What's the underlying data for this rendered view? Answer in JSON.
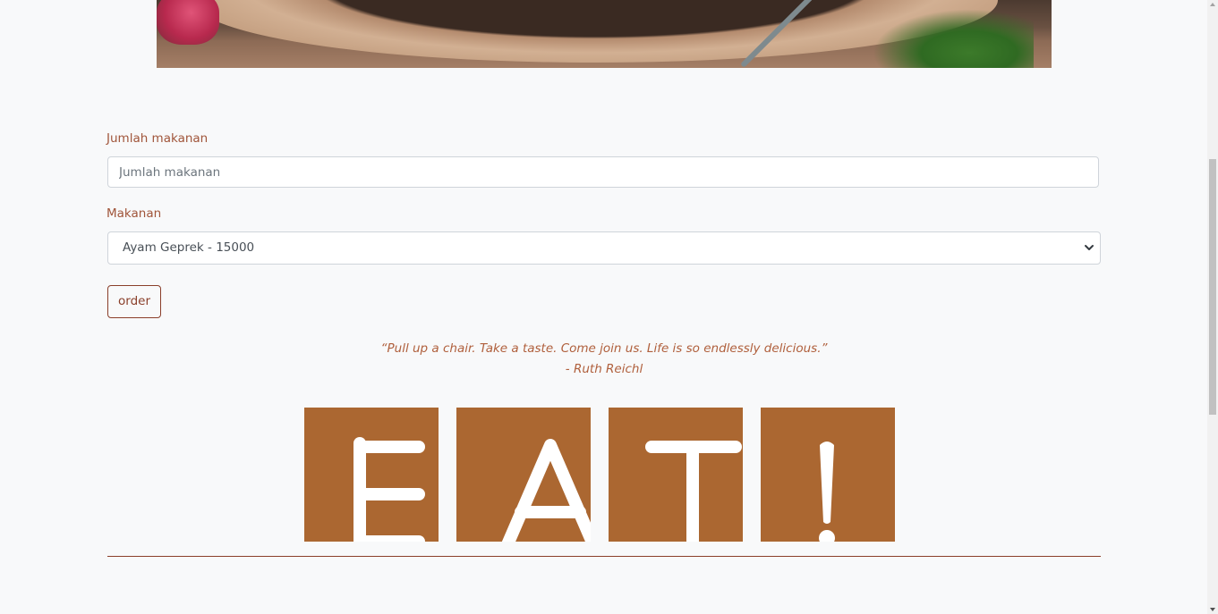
{
  "hero": {
    "image_name": "food-hero-image"
  },
  "form": {
    "quantity": {
      "label": "Jumlah makanan",
      "placeholder": "Jumlah makanan",
      "value": ""
    },
    "food": {
      "label": "Makanan",
      "selected": "Ayam Geprek - 15000"
    },
    "order_label": "order"
  },
  "quote": {
    "text": "“Pull up a chair. Take a taste. Come join us. Life is so endlessly delicious.”",
    "author": "- Ruth Reichl"
  },
  "tiles": {
    "letters": [
      "E",
      "A",
      "T",
      "!"
    ],
    "tile_color": "#ab6731",
    "letter_color": "#ffffff"
  },
  "colors": {
    "accent": "#a0553a",
    "button_border": "#8a3f2a",
    "background": "#f8f9fa"
  },
  "icons": {
    "select_arrow": "chevron-down-icon"
  }
}
